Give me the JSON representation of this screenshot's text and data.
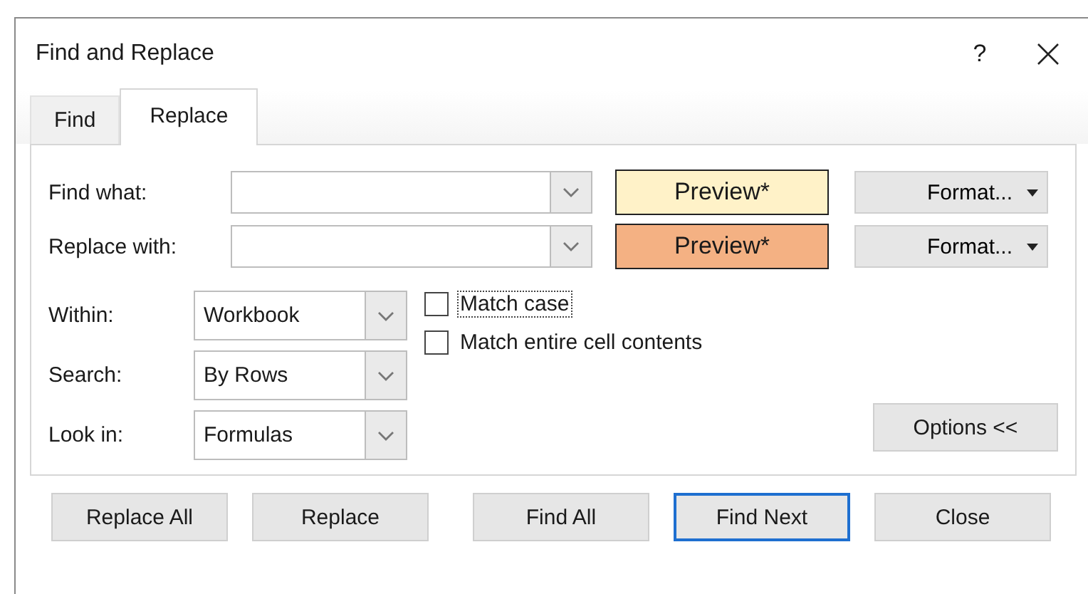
{
  "window": {
    "title": "Find and Replace",
    "help": "?"
  },
  "tabs": [
    {
      "label": "Find",
      "selected": false
    },
    {
      "label": "Replace",
      "selected": true
    }
  ],
  "fields": [
    {
      "label": "Find what:",
      "preview": "Preview*",
      "color": "#fff2c8",
      "format": "Format..."
    },
    {
      "label": "Replace with:",
      "preview": "Preview*",
      "color": "#f4b183",
      "format": "Format..."
    }
  ],
  "options": [
    {
      "label": "Within:",
      "value": "Workbook"
    },
    {
      "label": "Search:",
      "value": "By Rows"
    },
    {
      "label": "Look in:",
      "value": "Formulas"
    }
  ],
  "checkboxes": [
    {
      "label": "Match case",
      "checked": false,
      "focused": true
    },
    {
      "label": "Match entire cell contents",
      "checked": false,
      "focused": false
    }
  ],
  "options_button": "Options <<",
  "buttons": [
    {
      "label": "Replace All",
      "default": false
    },
    {
      "label": "Replace",
      "default": false
    },
    {
      "label": "Find All",
      "default": false
    },
    {
      "label": "Find Next",
      "default": true
    },
    {
      "label": "Close",
      "default": false
    }
  ]
}
